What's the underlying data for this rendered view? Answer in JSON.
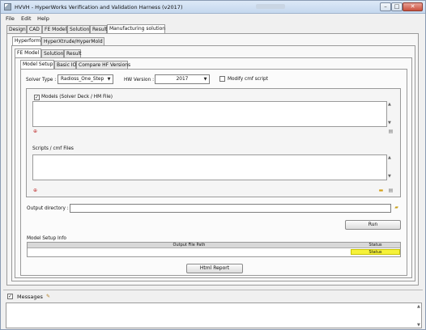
{
  "window": {
    "title": "HVVH - HyperWorks Verification and Validation Harness (v2017)",
    "controls": {
      "minimize": "–",
      "maximize": "□",
      "close": "✕"
    }
  },
  "menu": [
    "File",
    "Edit",
    "Help"
  ],
  "main_tabs": [
    "Design",
    "CAD",
    "FE Model",
    "Solution",
    "Result",
    "Manufacturing solution"
  ],
  "main_tabs_active": "Manufacturing solution",
  "sub_tabs": [
    "Hyperform",
    "HyperXtrude/HyperMold"
  ],
  "sub_tabs_active": "Hyperform",
  "stage_tabs": [
    "FE Model",
    "Solution",
    "Result"
  ],
  "stage_tabs_active": "FE Model",
  "section_tabs": [
    "Model Setup",
    "Basic IO",
    "Compare HF Versions"
  ],
  "section_tabs_active": "Model Setup",
  "model_setup": {
    "solver_type_label": "Solver Type :",
    "solver_type_value": "Radioss_One_Step",
    "hw_version_label": "HW Version :",
    "hw_version_value": "2017",
    "modify_cmf_label": "Modify cmf script",
    "modify_cmf_checked": false,
    "models_label": "Models (Solver Deck / HM File)",
    "models_checked": true,
    "scripts_label": "Scripts / cmf Files",
    "output_dir_label": "Output directory :",
    "output_dir_value": "",
    "run_label": "Run",
    "setup_info_label": "Model Setup Info",
    "table_headers": [
      "Output File Path",
      "Status"
    ],
    "table_rows": [
      {
        "path": "",
        "status": "Status"
      }
    ],
    "html_report_label": "Html Report",
    "status_color": "#f6f23a"
  },
  "messages": {
    "label": "Messages",
    "checked": true
  },
  "icons": {
    "models_add": "add-file-icon",
    "models_remove": "remove-file-icon",
    "scripts_add": "add-file-icon",
    "scripts_folder": "folder-icon",
    "scripts_remove": "remove-file-icon",
    "output_browse": "folder-open-icon",
    "messages_edit": "pencil-icon"
  }
}
